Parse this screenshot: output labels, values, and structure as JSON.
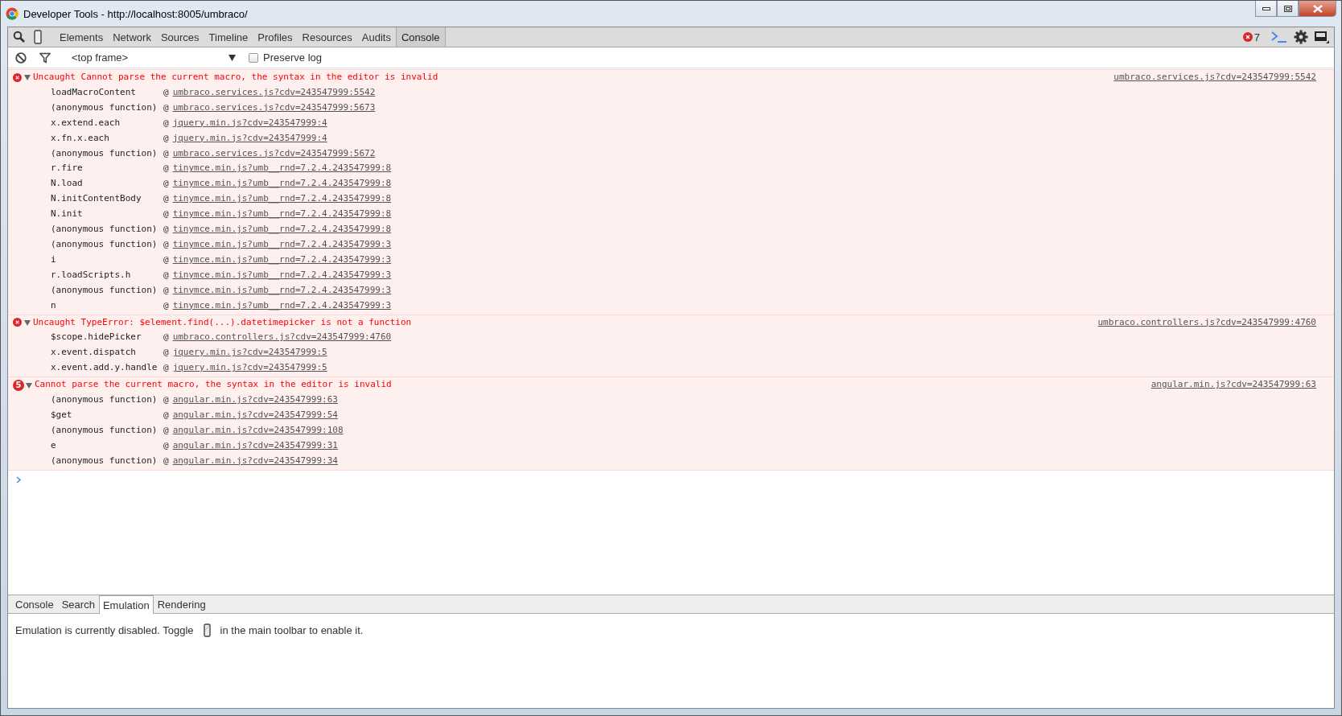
{
  "window": {
    "title": "Developer Tools - http://localhost:8005/umbraco/"
  },
  "panel_tabs": [
    {
      "label": "Elements",
      "selected": false
    },
    {
      "label": "Network",
      "selected": false
    },
    {
      "label": "Sources",
      "selected": false
    },
    {
      "label": "Timeline",
      "selected": false
    },
    {
      "label": "Profiles",
      "selected": false
    },
    {
      "label": "Resources",
      "selected": false
    },
    {
      "label": "Audits",
      "selected": false
    },
    {
      "label": "Console",
      "selected": true
    }
  ],
  "error_count": "7",
  "filter_bar": {
    "frame": "<top frame>",
    "preserve_log": {
      "label": "Preserve log",
      "checked": false
    }
  },
  "messages": [
    {
      "text": "Uncaught Cannot parse the current macro, the syntax in the editor is invalid",
      "source": "umbraco.services.js?cdv=243547999:5542",
      "expanded": true,
      "frames": [
        {
          "function": "loadMacroContent",
          "at": "@",
          "location": "umbraco.services.js?cdv=243547999:5542"
        },
        {
          "function": "(anonymous function)",
          "at": "@",
          "location": "umbraco.services.js?cdv=243547999:5673"
        },
        {
          "function": "x.extend.each",
          "at": "@",
          "location": "jquery.min.js?cdv=243547999:4"
        },
        {
          "function": "x.fn.x.each",
          "at": "@",
          "location": "jquery.min.js?cdv=243547999:4"
        },
        {
          "function": "(anonymous function)",
          "at": "@",
          "location": "umbraco.services.js?cdv=243547999:5672"
        },
        {
          "function": "r.fire",
          "at": "@",
          "location": "tinymce.min.js?umb__rnd=7.2.4.243547999:8"
        },
        {
          "function": "N.load",
          "at": "@",
          "location": "tinymce.min.js?umb__rnd=7.2.4.243547999:8"
        },
        {
          "function": "N.initContentBody",
          "at": "@",
          "location": "tinymce.min.js?umb__rnd=7.2.4.243547999:8"
        },
        {
          "function": "N.init",
          "at": "@",
          "location": "tinymce.min.js?umb__rnd=7.2.4.243547999:8"
        },
        {
          "function": "(anonymous function)",
          "at": "@",
          "location": "tinymce.min.js?umb__rnd=7.2.4.243547999:8"
        },
        {
          "function": "(anonymous function)",
          "at": "@",
          "location": "tinymce.min.js?umb__rnd=7.2.4.243547999:3"
        },
        {
          "function": "i",
          "at": "@",
          "location": "tinymce.min.js?umb__rnd=7.2.4.243547999:3"
        },
        {
          "function": "r.loadScripts.h",
          "at": "@",
          "location": "tinymce.min.js?umb__rnd=7.2.4.243547999:3"
        },
        {
          "function": "(anonymous function)",
          "at": "@",
          "location": "tinymce.min.js?umb__rnd=7.2.4.243547999:3"
        },
        {
          "function": "n",
          "at": "@",
          "location": "tinymce.min.js?umb__rnd=7.2.4.243547999:3"
        }
      ]
    },
    {
      "text": "Uncaught TypeError: $element.find(...).datetimepicker is not a function",
      "source": "umbraco.controllers.js?cdv=243547999:4760",
      "expanded": true,
      "frames": [
        {
          "function": "$scope.hidePicker",
          "at": "@",
          "location": "umbraco.controllers.js?cdv=243547999:4760"
        },
        {
          "function": "x.event.dispatch",
          "at": "@",
          "location": "jquery.min.js?cdv=243547999:5"
        },
        {
          "function": "x.event.add.y.handle",
          "at": "@",
          "location": "jquery.min.js?cdv=243547999:5"
        }
      ]
    },
    {
      "text": "Cannot parse the current macro, the syntax in the editor is invalid",
      "source": "angular.min.js?cdv=243547999:63",
      "repeat_count": "5",
      "expanded": true,
      "frames": [
        {
          "function": "(anonymous function)",
          "at": "@",
          "location": "angular.min.js?cdv=243547999:63"
        },
        {
          "function": "$get",
          "at": "@",
          "location": "angular.min.js?cdv=243547999:54"
        },
        {
          "function": "(anonymous function)",
          "at": "@",
          "location": "angular.min.js?cdv=243547999:108"
        },
        {
          "function": "e",
          "at": "@",
          "location": "angular.min.js?cdv=243547999:31"
        },
        {
          "function": "(anonymous function)",
          "at": "@",
          "location": "angular.min.js?cdv=243547999:34"
        }
      ]
    }
  ],
  "drawer": {
    "tabs": [
      {
        "label": "Console",
        "selected": false
      },
      {
        "label": "Search",
        "selected": false
      },
      {
        "label": "Emulation",
        "selected": true
      },
      {
        "label": "Rendering",
        "selected": false
      }
    ],
    "message_before_icon": "Emulation is currently disabled. Toggle",
    "message_after_icon": "in the main toolbar to enable it."
  }
}
